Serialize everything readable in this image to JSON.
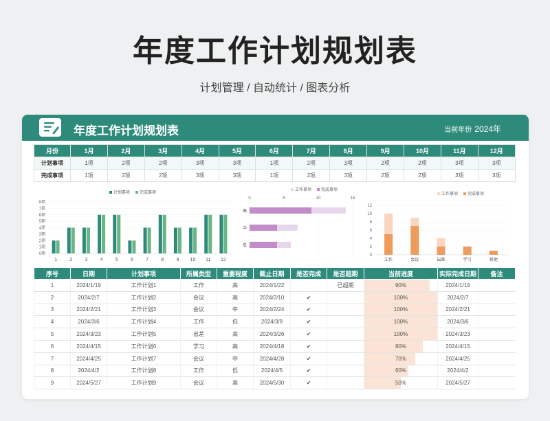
{
  "page": {
    "title": "年度工作计划规划表",
    "subtitle": "计划管理 / 自动统计 / 图表分析"
  },
  "card": {
    "title": "年度工作计划规划表",
    "year_label": "当前年份",
    "year_value": "2024年",
    "doc_icon": "document-edit-icon"
  },
  "colors": {
    "primary": "#2e8b7c",
    "secondary": "#6ab584",
    "purple_dark": "#c18cc8",
    "purple_light": "#e8d6ec",
    "orange_dark": "#ee9b5e",
    "orange_light": "#fbd6bf",
    "progress": "#fbe4d5"
  },
  "summary": {
    "header_label": "月份",
    "months": [
      "1月",
      "2月",
      "3月",
      "4月",
      "5月",
      "6月",
      "7月",
      "8月",
      "9月",
      "10月",
      "11月",
      "12月"
    ],
    "rows": [
      {
        "label": "计划事项",
        "values": [
          "1项",
          "2项",
          "2项",
          "3项",
          "3项",
          "1项",
          "2项",
          "3项",
          "2项",
          "2项",
          "3项",
          "3项"
        ]
      },
      {
        "label": "完成事项",
        "values": [
          "1项",
          "2项",
          "2项",
          "3项",
          "3项",
          "1项",
          "2项",
          "3项",
          "2项",
          "2项",
          "3项",
          "3项"
        ]
      }
    ]
  },
  "chart_data": [
    {
      "type": "bar",
      "legend": [
        "计划事项",
        "完成事项"
      ],
      "categories": [
        "1",
        "2",
        "3",
        "4",
        "5",
        "6",
        "7",
        "8",
        "9",
        "10",
        "11",
        "12"
      ],
      "y_ticks": [
        "0项",
        "1项",
        "2项",
        "3项",
        "4项",
        "5项",
        "6项",
        "7项",
        "8项"
      ],
      "ylim": [
        0,
        8
      ],
      "series": [
        {
          "name": "计划事项",
          "color": "#2e8b7c",
          "values": [
            2,
            4,
            4,
            6,
            6,
            2,
            4,
            6,
            4,
            4,
            6,
            6
          ]
        },
        {
          "name": "完成事项",
          "color": "#6ab584",
          "values": [
            2,
            4,
            4,
            6,
            6,
            2,
            4,
            6,
            4,
            4,
            6,
            6
          ]
        }
      ]
    },
    {
      "type": "bar",
      "orientation": "horizontal",
      "legend": [
        "工作事项",
        "完成事项"
      ],
      "categories": [
        "高",
        "中",
        "低"
      ],
      "x_ticks": [
        "0",
        "5",
        "10",
        "15"
      ],
      "xlim": [
        0,
        15
      ],
      "series": [
        {
          "name": "工作事项",
          "color": "#e8d6ec",
          "values": [
            14,
            7,
            6
          ]
        },
        {
          "name": "完成事项",
          "color": "#c18cc8",
          "values": [
            9,
            4,
            4
          ]
        }
      ]
    },
    {
      "type": "bar",
      "legend": [
        "工作事项",
        "完成事项"
      ],
      "categories": [
        "工作",
        "会议",
        "出差",
        "学习",
        "其他"
      ],
      "y_ticks": [
        "0",
        "2",
        "4",
        "6",
        "8",
        "10",
        "12"
      ],
      "ylim": [
        0,
        12
      ],
      "series": [
        {
          "name": "工作事项",
          "color": "#fbd6bf",
          "values": [
            10,
            9,
            4,
            2,
            1
          ]
        },
        {
          "name": "完成事项",
          "color": "#ee9b5e",
          "values": [
            5,
            7,
            2,
            2,
            1
          ]
        }
      ]
    }
  ],
  "detail": {
    "headers": [
      "序号",
      "日期",
      "计划事项",
      "所属类型",
      "重要程度",
      "截止日期",
      "是否完成",
      "是否超期",
      "当前进度",
      "实际完成日期",
      "备注"
    ],
    "rows": [
      {
        "no": "1",
        "date": "2024/1/19",
        "item": "工作计划1",
        "type": "工作",
        "priority": "高",
        "deadline": "2024/1/22",
        "done": "",
        "overdue": "已超期",
        "progress_text": "90%",
        "progress": 0.9,
        "actual": "2024/1/19",
        "note": ""
      },
      {
        "no": "2",
        "date": "2024/2/7",
        "item": "工作计划2",
        "type": "会议",
        "priority": "高",
        "deadline": "2024/2/10",
        "done": "✔",
        "overdue": "",
        "progress_text": "100%",
        "progress": 1.0,
        "actual": "2024/2/7",
        "note": ""
      },
      {
        "no": "3",
        "date": "2024/2/21",
        "item": "工作计划3",
        "type": "会议",
        "priority": "中",
        "deadline": "2024/2/24",
        "done": "✔",
        "overdue": "",
        "progress_text": "100%",
        "progress": 1.0,
        "actual": "2024/2/21",
        "note": ""
      },
      {
        "no": "4",
        "date": "2024/3/6",
        "item": "工作计划4",
        "type": "工作",
        "priority": "低",
        "deadline": "2024/3/9",
        "done": "✔",
        "overdue": "",
        "progress_text": "100%",
        "progress": 1.0,
        "actual": "2024/3/6",
        "note": ""
      },
      {
        "no": "5",
        "date": "2024/3/23",
        "item": "工作计划5",
        "type": "出差",
        "priority": "高",
        "deadline": "2024/3/26",
        "done": "✔",
        "overdue": "",
        "progress_text": "100%",
        "progress": 1.0,
        "actual": "2024/3/23",
        "note": ""
      },
      {
        "no": "6",
        "date": "2024/4/15",
        "item": "工作计划6",
        "type": "学习",
        "priority": "高",
        "deadline": "2024/4/18",
        "done": "✔",
        "overdue": "",
        "progress_text": "80%",
        "progress": 0.8,
        "actual": "2024/4/15",
        "note": ""
      },
      {
        "no": "7",
        "date": "2024/4/25",
        "item": "工作计划7",
        "type": "会议",
        "priority": "中",
        "deadline": "2024/4/28",
        "done": "✔",
        "overdue": "",
        "progress_text": "70%",
        "progress": 0.7,
        "actual": "2024/4/25",
        "note": ""
      },
      {
        "no": "8",
        "date": "2024/4/2",
        "item": "工作计划8",
        "type": "工作",
        "priority": "低",
        "deadline": "2024/4/5",
        "done": "✔",
        "overdue": "",
        "progress_text": "60%",
        "progress": 0.6,
        "actual": "2024/4/2",
        "note": ""
      },
      {
        "no": "9",
        "date": "2024/5/27",
        "item": "工作计划9",
        "type": "会议",
        "priority": "高",
        "deadline": "2024/5/30",
        "done": "✔",
        "overdue": "",
        "progress_text": "50%",
        "progress": 0.5,
        "actual": "2024/5/27",
        "note": ""
      }
    ]
  }
}
